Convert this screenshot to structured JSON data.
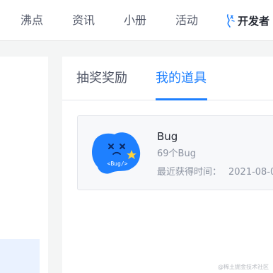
{
  "topnav": {
    "items": [
      {
        "label": "沸点"
      },
      {
        "label": "资讯"
      },
      {
        "label": "小册"
      },
      {
        "label": "活动"
      }
    ],
    "creator_label": "开发者"
  },
  "panel": {
    "tabs": [
      {
        "label": "抽奖奖励",
        "active": false
      },
      {
        "label": "我的道具",
        "active": true
      }
    ],
    "item_card": {
      "title": "Bug",
      "count_text": "69个Bug",
      "time_label": "最近获得时间：",
      "time_value": "2021-08-0",
      "image_text": "<Bug/>"
    }
  },
  "watermark": "@稀土掘金技术社区",
  "colors": {
    "accent": "#1e80ff",
    "star": "#ffd33d",
    "page_bg": "#f4f5f5"
  }
}
